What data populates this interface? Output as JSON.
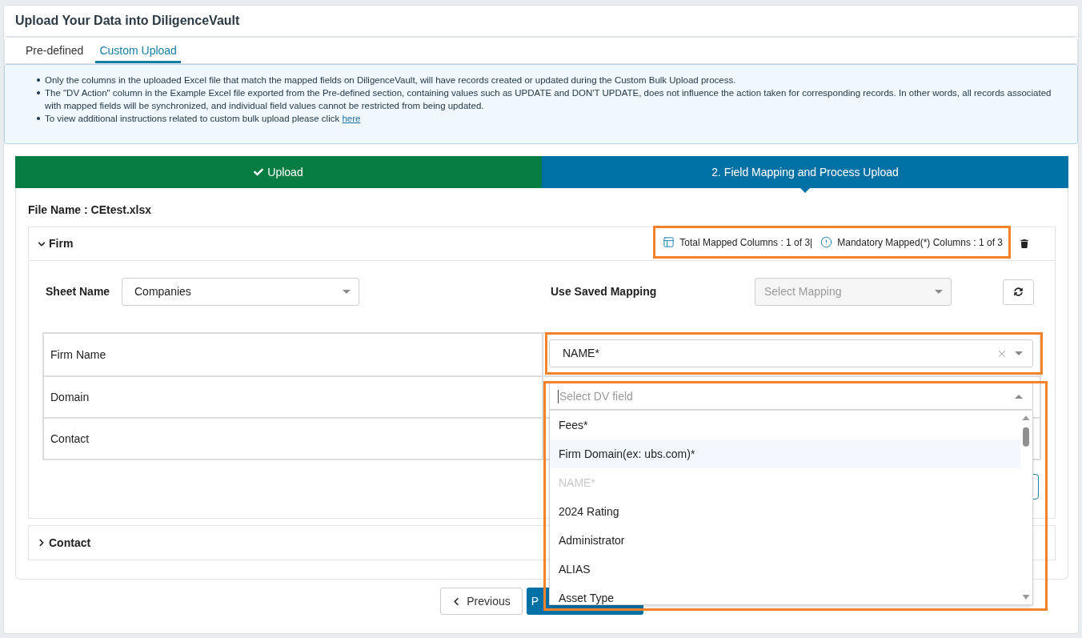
{
  "page": {
    "title": "Upload Your Data into DiligenceVault"
  },
  "tabs": [
    {
      "label": "Pre-defined",
      "selected": false
    },
    {
      "label": "Custom Upload",
      "selected": true
    }
  ],
  "info": {
    "bullets": [
      {
        "text": "Only the columns in the uploaded Excel file that match the mapped fields on DiligenceVault, will have records created or updated during the Custom Bulk Upload process."
      },
      {
        "text": "The \"DV Action\" column in the Example Excel file exported from the Pre-defined section, containing values such as UPDATE and DON'T UPDATE, does not influence the action taken for corresponding records. In other words, all records associated with mapped fields will be synchronized, and individual field values cannot be restricted from being updated."
      },
      {
        "text": "To view additional instructions related to custom bulk upload please click",
        "link": "here"
      }
    ]
  },
  "steps": [
    {
      "label": "Upload",
      "kind": "done"
    },
    {
      "label": "2. Field Mapping and Process Upload",
      "kind": "current"
    }
  ],
  "file_name": "File Name : CEtest.xlsx",
  "sections": [
    {
      "title": "Firm",
      "expanded": true,
      "counts": {
        "highlighted": true,
        "total_mapped": "Total Mapped Columns : 1 of 3|",
        "mandatory_mapped": "Mandatory Mapped(*) Columns : 1 of 3"
      },
      "sheet_name": {
        "label": "Sheet Name",
        "value": "Companies"
      },
      "saved_mapping": {
        "label": "Use Saved Mapping",
        "placeholder": "Select Mapping",
        "disabled": true
      },
      "rows": [
        {
          "column": "Firm Name",
          "field": {
            "value": "NAME*",
            "open": false,
            "highlighted": true
          }
        },
        {
          "column": "Domain",
          "field": {
            "placeholder": "Select DV field",
            "open": true,
            "highlighted": true,
            "options": [
              {
                "label": "Fees*",
                "selected": false,
                "disabled": false
              },
              {
                "label": "Firm Domain(ex: ubs.com)*",
                "selected": true,
                "disabled": false
              },
              {
                "label": "NAME*",
                "selected": false,
                "disabled": true
              },
              {
                "label": "2024 Rating",
                "selected": false,
                "disabled": false
              },
              {
                "label": "Administrator",
                "selected": false,
                "disabled": false
              },
              {
                "label": "ALIAS",
                "selected": false,
                "disabled": false
              },
              {
                "label": "Asset Type",
                "selected": false,
                "disabled": false
              }
            ]
          }
        },
        {
          "column": "Contact"
        }
      ]
    },
    {
      "title": "Contact",
      "expanded": false
    }
  ],
  "footer_buttons": [
    {
      "label": "Previous",
      "kind": "back"
    },
    {
      "label": "P",
      "kind": "primary"
    }
  ]
}
